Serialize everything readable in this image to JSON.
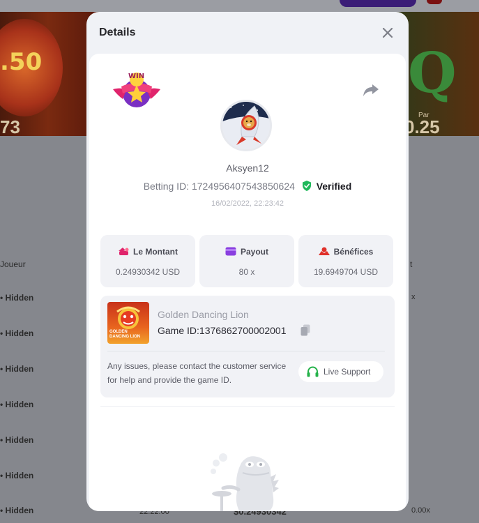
{
  "background": {
    "lantern_value": ".50",
    "left_value": "73",
    "right_value": "0.25",
    "right_caption": "Par",
    "column_header_left": "Joueur",
    "column_header_right": "t",
    "row_label": "Hidden",
    "row_right_marker": "x",
    "bottom_time": "22:22:00",
    "bottom_amount": "$0.24930342",
    "bottom_right": "0.00x"
  },
  "modal": {
    "title": "Details",
    "badge_text": "WIN",
    "username": "Aksyen12",
    "betting_id_label": "Betting ID: 1724956407543850624",
    "verified_label": "Verified",
    "datetime": "16/02/2022, 22:23:42",
    "stats": [
      {
        "label": "Le Montant",
        "value": "0.24930342 USD",
        "icon": "coins-icon"
      },
      {
        "label": "Payout",
        "value": "80 x",
        "icon": "wallet-icon"
      },
      {
        "label": "Bénéfices",
        "value": "19.6949704 USD",
        "icon": "profit-icon"
      }
    ],
    "game": {
      "thumb_title_1": "GOLDEN",
      "thumb_title_2": "DANCING LION",
      "name": "Golden Dancing Lion",
      "id_label": "Game ID:1376862700002001"
    },
    "support_text": "Any issues, please contact the customer service for help and provide the game ID.",
    "live_support_label": "Live Support",
    "colors": {
      "accent": "#5b3fd1",
      "verified": "#1fb85a",
      "support_green": "#24b24a",
      "badge_pink": "#e0246c",
      "badge_purple": "#7a2fc2"
    }
  }
}
